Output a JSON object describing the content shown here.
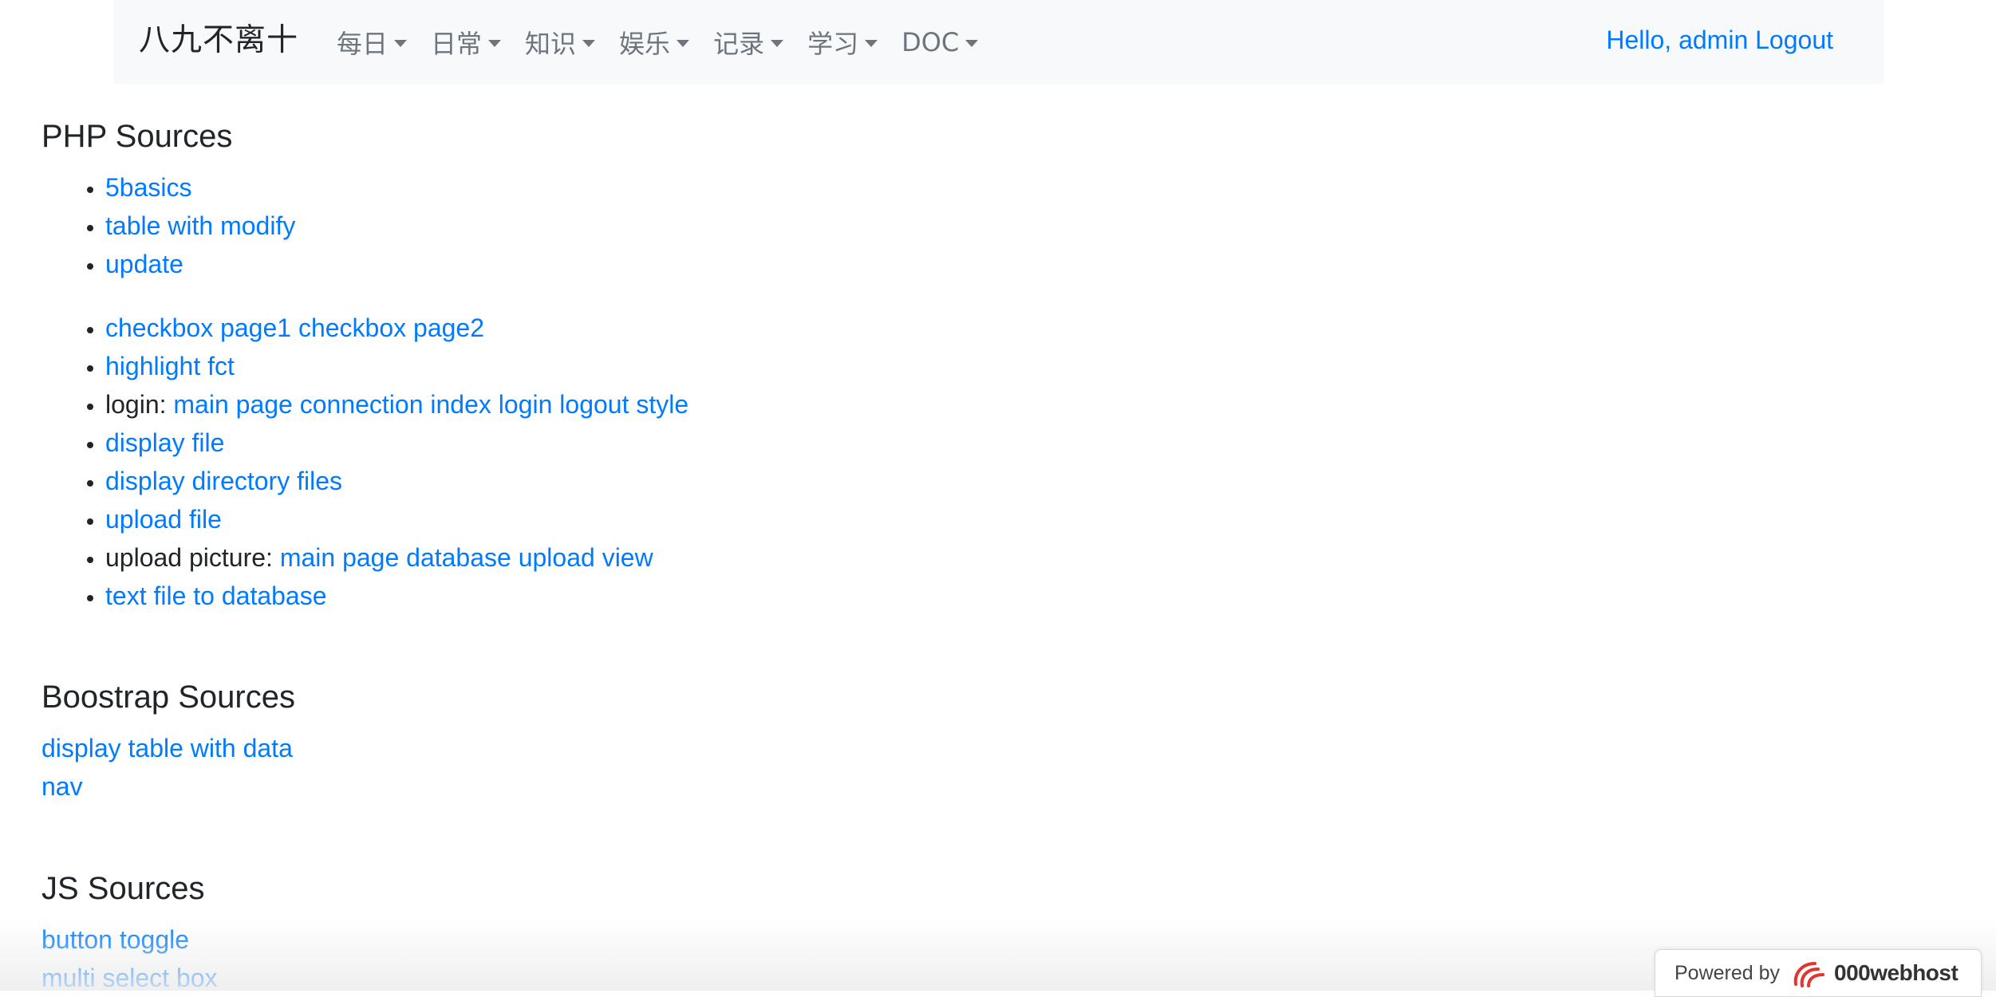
{
  "navbar": {
    "brand": "八九不离十",
    "menus": [
      {
        "label": "每日"
      },
      {
        "label": "日常"
      },
      {
        "label": "知识"
      },
      {
        "label": "娱乐"
      },
      {
        "label": "记录"
      },
      {
        "label": "学习"
      },
      {
        "label": "DOC"
      }
    ],
    "user_greeting": "Hello, admin",
    "logout_label": "Logout"
  },
  "php_sources": {
    "title": "PHP Sources",
    "group1": [
      "5basics",
      "table with modify",
      "update"
    ],
    "checkbox_links": [
      "checkbox page1",
      "checkbox page2"
    ],
    "highlight": "highlight fct",
    "login_prefix": "login:",
    "login_links": [
      "main page",
      "connection",
      "index",
      "login",
      "logout",
      "style"
    ],
    "display_file": "display file",
    "display_dir": "display directory files",
    "upload_file": "upload file",
    "upload_picture_prefix": "upload picture:",
    "upload_picture_links": [
      "main page",
      "database",
      "upload",
      "view"
    ],
    "text_to_db": "text file to database"
  },
  "bootstrap_sources": {
    "title": "Boostrap Sources",
    "links": [
      "display table with data",
      "nav"
    ]
  },
  "js_sources": {
    "title": "JS Sources",
    "links": [
      "button toggle",
      "multi select box"
    ]
  },
  "footer_badge": {
    "powered_by": "Powered by",
    "host": "000webhost"
  }
}
